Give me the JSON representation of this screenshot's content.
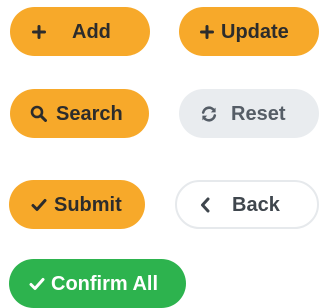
{
  "buttons": {
    "add": {
      "label": "Add",
      "icon": "plus-icon",
      "color": "#f7a92a"
    },
    "update": {
      "label": "Update",
      "icon": "plus-icon",
      "color": "#f7a92a"
    },
    "search": {
      "label": "Search",
      "icon": "search-icon",
      "color": "#f7a92a"
    },
    "reset": {
      "label": "Reset",
      "icon": "refresh-icon",
      "color": "#e9ecef"
    },
    "submit": {
      "label": "Submit",
      "icon": "check-icon",
      "color": "#f7a92a"
    },
    "back": {
      "label": "Back",
      "icon": "chevron-left-icon",
      "color": "#ffffff"
    },
    "confirm_all": {
      "label": "Confirm All",
      "icon": "check-icon",
      "color": "#2db34e"
    }
  }
}
